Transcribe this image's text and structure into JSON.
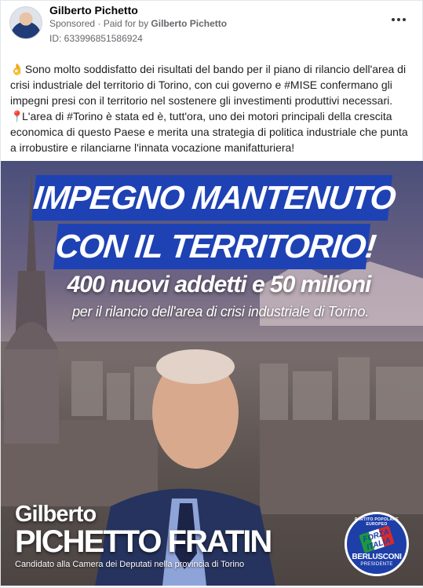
{
  "post": {
    "author": "Gilberto Pichetto",
    "sponsored_label": "Sponsored",
    "paid_for_prefix": " · Paid for by ",
    "paid_for_name": "Gilberto Pichetto",
    "ad_id": "ID: 633996851586924",
    "more_icon": "more-horizontal-icon",
    "paragraph1": "Sono molto soddisfatto dei risultati del bando per il piano di rilancio dell'area di crisi industriale del territorio di Torino, con cui governo e #MISE confermano gli impegni presi con il territorio nel sostenere gli investimenti produttivi necessari.",
    "paragraph2": "L'area di #Torino è stata ed è, tutt'ora, uno dei motori principali della crescita economica di questo Paese e merita una strategia di politica industriale che punta a irrobustire e rilanciarne l'innata vocazione manifatturiera!",
    "emoji1": "👌",
    "emoji2": "📍"
  },
  "creative": {
    "headline_line1": "IMPEGNO MANTENUTO",
    "headline_line2": "CON IL TERRITORIO!",
    "subheadline": "400 nuovi addetti e 50 milioni",
    "tagline": "per il rilancio dell'area di crisi industriale di Torino.",
    "first_name": "Gilberto",
    "last_name": "PICHETTO FRATIN",
    "candidate_line": "Candidato alla Camera dei Deputati nella provincia di Torino",
    "logo": {
      "ring_text": "PARTITO POPOLARE EUROPEO",
      "forza": "FORZA ITALIA",
      "berlusconi": "BERLUSCONI",
      "presidente": "PRESIDENTE"
    },
    "colors": {
      "banner_blue": "#1e42b4",
      "logo_blue": "#1e3fa8"
    }
  }
}
